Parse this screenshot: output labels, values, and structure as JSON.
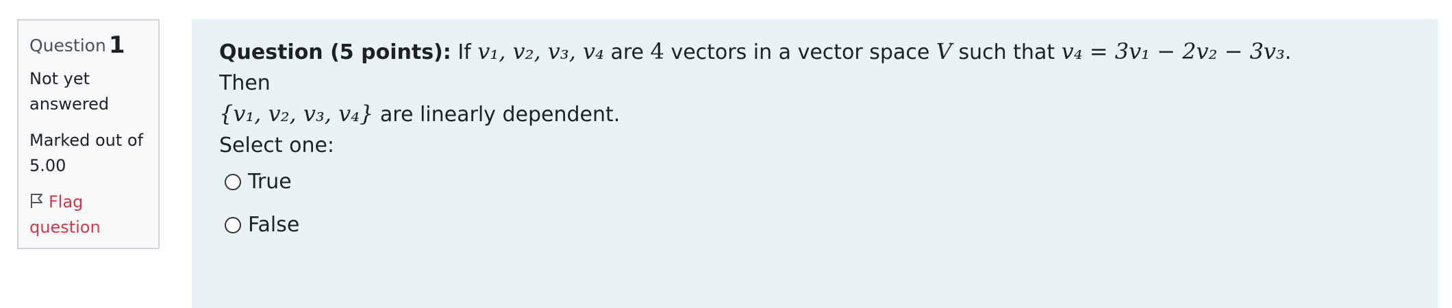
{
  "info": {
    "question_word": "Question",
    "question_number": "1",
    "state": "Not yet answered",
    "grade": "Marked out of 5.00",
    "flag_label": "Flag question",
    "flag_icon": "flag-icon"
  },
  "question": {
    "lead": "Question (5 points):",
    "text_if": "If",
    "vectors": "v₁, v₂, v₃, v₄",
    "text_are": "are",
    "count": "4",
    "text_vectors_in": "vectors in a vector space",
    "space": "V",
    "text_such_that": "such that",
    "equation": "v₄ = 3v₁ − 2v₂ − 3v₃",
    "text_then": ". Then",
    "set": "{v₁, v₂, v₃, v₄}",
    "text_conclusion": "are linearly dependent."
  },
  "answer": {
    "prompt": "Select one:",
    "options": [
      {
        "label": "True",
        "selected": false
      },
      {
        "label": "False",
        "selected": false
      }
    ]
  },
  "colors": {
    "content_bg": "#e7f3f5",
    "info_bg": "#f8f9fa",
    "flag": "#d63646"
  }
}
